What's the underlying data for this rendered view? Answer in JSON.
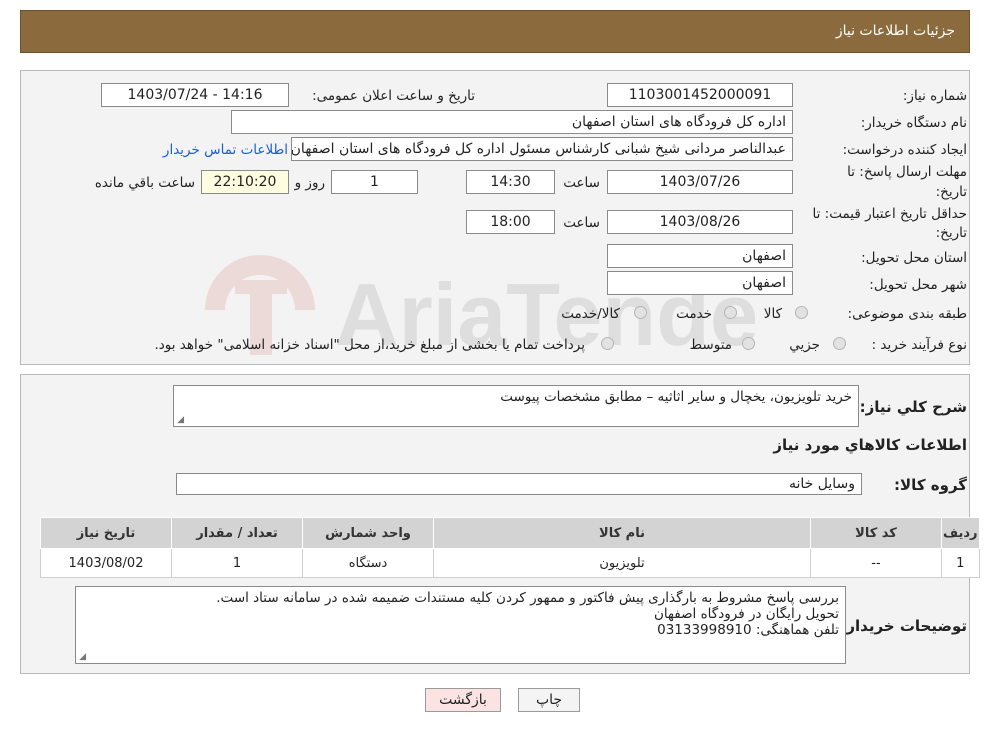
{
  "header": {
    "title": "جزئیات اطلاعات نیاز"
  },
  "fields": {
    "need_number_label": "شماره نیاز:",
    "need_number": "1103001452000091",
    "announce_label": "تاریخ و ساعت اعلان عمومی:",
    "announce_value": "1403/07/24 - 14:16",
    "buyer_org_label": "نام دستگاه خریدار:",
    "buyer_org": "اداره کل فرودگاه های استان اصفهان",
    "creator_label": "ایجاد کننده درخواست:",
    "creator": "عبدالناصر مردانی شیخ شبانی کارشناس مسئول  اداره کل فرودگاه های استان اصفهان",
    "contact_link": "اطلاعات تماس خریدار",
    "deadline_label_1": "مهلت ارسال پاسخ: تا",
    "deadline_label_2": "تاریخ:",
    "deadline_date": "1403/07/26",
    "time_label": "ساعت",
    "deadline_time": "14:30",
    "days_value": "1",
    "days_label": "روز و",
    "remaining_time": "22:10:20",
    "remaining_label": "ساعت باقي مانده",
    "validity_label_1": "حداقل تاریخ اعتبار قیمت: تا",
    "validity_label_2": "تاریخ:",
    "validity_date": "1403/08/26",
    "validity_time": "18:00",
    "province_label": "استان محل تحویل:",
    "province": "اصفهان",
    "city_label": "شهر محل تحویل:",
    "city": "اصفهان",
    "category_label": "طبقه بندی موضوعی:",
    "category_options": [
      "کالا",
      "خدمت",
      "کالا/خدمت"
    ],
    "process_label": "نوع فرآیند خرید :",
    "process_options": [
      "جزيي",
      "متوسط"
    ],
    "process_note": "پرداخت تمام یا بخشی از مبلغ خرید،از محل \"اسناد خزانه اسلامی\" خواهد بود."
  },
  "description": {
    "label": "شرح کلي نياز:",
    "text": "خرید تلویزیون، یخچال و سایر اثاثیه  – مطابق مشخصات پیوست"
  },
  "goods": {
    "section_title": "اطلاعات کالاهاي مورد نياز",
    "group_label": "گروه کالا:",
    "group_value": "وسایل خانه",
    "columns": [
      "رديف",
      "کد کالا",
      "نام کالا",
      "واحد شمارش",
      "تعداد / مقدار",
      "تاریخ نیاز"
    ],
    "rows": [
      [
        "1",
        "--",
        "تلویزیون",
        "دستگاه",
        "1",
        "1403/08/02"
      ]
    ]
  },
  "buyer_notes": {
    "label": "توضیحات خریدار:",
    "lines": [
      "بررسی پاسخ مشروط  به بارگذاری پیش فاکتور و ممهور کردن کلیه مستندات ضمیمه شده در سامانه  ستاد است.",
      "تحویل رایگان در فرودگاه اصفهان",
      "تلفن هماهنگی: 03133998910"
    ]
  },
  "buttons": {
    "print": "چاپ",
    "back": "بازگشت"
  },
  "colors": {
    "header_bg": "#8b6a3e",
    "back_button_bg": "#fbe3e3",
    "link": "#1a5fd0"
  }
}
